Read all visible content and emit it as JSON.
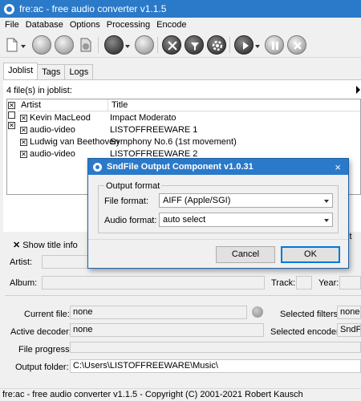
{
  "window": {
    "title": "fre:ac - free audio converter v1.1.5"
  },
  "menu": [
    "File",
    "Database",
    "Options",
    "Processing",
    "Encode"
  ],
  "tabs": [
    "Joblist",
    "Tags",
    "Logs"
  ],
  "joblist": {
    "count_label": "4 file(s) in joblist:",
    "columns": {
      "artist": "Artist",
      "title": "Title"
    },
    "rows": [
      {
        "artist": "Kevin MacLeod",
        "title": "Impact Moderato"
      },
      {
        "artist": "audio-video",
        "title": "LISTOFFREEWARE 1"
      },
      {
        "artist": "Ludwig van Beethoven",
        "title": "Symphony No.6 (1st movement)"
      },
      {
        "artist": "audio-video",
        "title": "LISTOFFREEWARE 2"
      }
    ]
  },
  "title_info": {
    "toggle": "Show title info",
    "artist_label": "Artist:",
    "album_label": "Album:",
    "track_label": "Track:",
    "year_label": "Year:",
    "list_label": "st"
  },
  "status": {
    "current_file_label": "Current file:",
    "current_file": "none",
    "selected_filters_label": "Selected filters:",
    "selected_filters": "none",
    "active_decoder_label": "Active decoder:",
    "active_decoder": "none",
    "selected_encoder_label": "Selected encoder:",
    "selected_encoder": "SndFil",
    "file_progress_label": "File progress:",
    "output_folder_label": "Output folder:",
    "output_folder": "C:\\Users\\LISTOFFREEWARE\\Music\\"
  },
  "statusbar": "fre:ac - free audio converter v1.1.5 - Copyright (C) 2001-2021 Robert Kausch",
  "dialog": {
    "title": "SndFile Output Component v1.0.31",
    "close": "×",
    "group": "Output format",
    "file_format_label": "File format:",
    "file_format_value": "AIFF (Apple/SGI)",
    "audio_format_label": "Audio format:",
    "audio_format_value": "auto select",
    "cancel": "Cancel",
    "ok": "OK"
  },
  "colors": {
    "titlebar": "#2b79c9",
    "accent": "#0078d7"
  }
}
